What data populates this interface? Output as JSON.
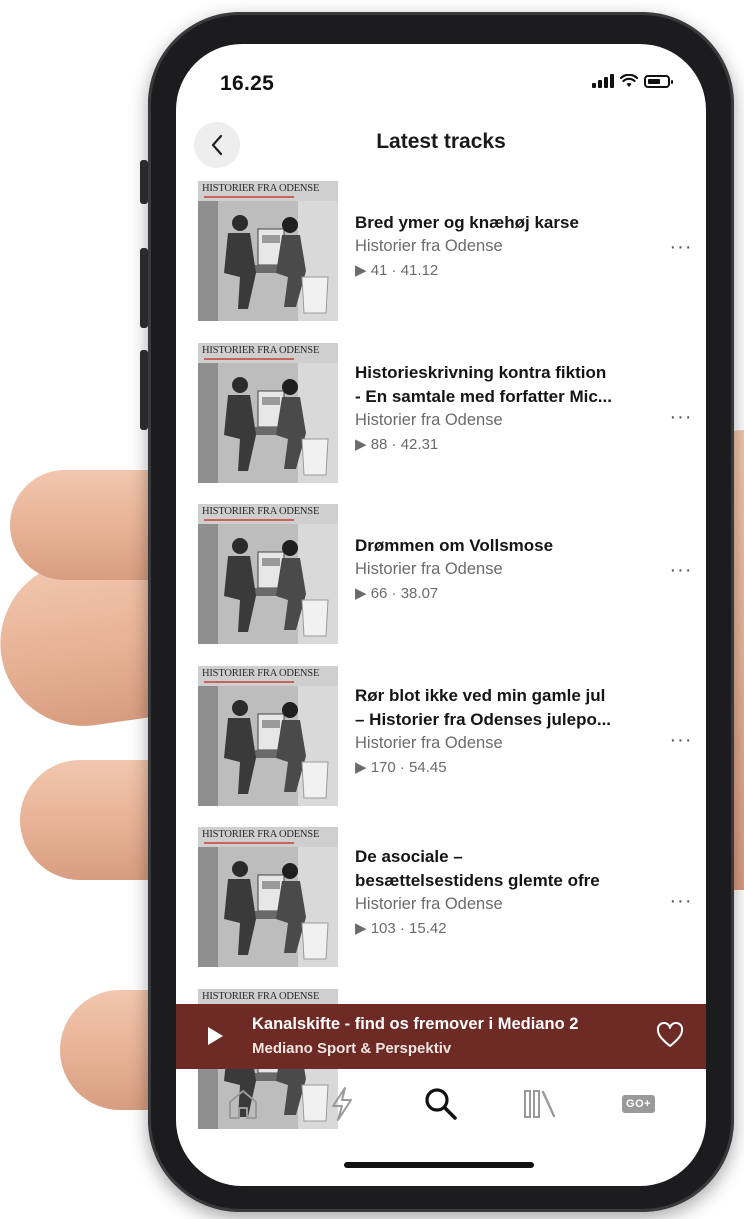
{
  "status_bar": {
    "time": "16.25"
  },
  "header": {
    "title": "Latest tracks"
  },
  "cover": {
    "title": "HISTORIER FRA ODENSE"
  },
  "tracks": [
    {
      "title_lines": [
        "Bred ymer og knæhøj karse"
      ],
      "show": "Historier fra Odense",
      "meta": "▶ 41 · 41.12"
    },
    {
      "title_lines": [
        "Historieskrivning kontra fiktion",
        "- En samtale med forfatter Mic..."
      ],
      "show": "Historier fra Odense",
      "meta": "▶ 88 · 42.31"
    },
    {
      "title_lines": [
        "Drømmen om Vollsmose"
      ],
      "show": "Historier fra Odense",
      "meta": "▶ 66 · 38.07"
    },
    {
      "title_lines": [
        "Rør blot ikke ved min gamle jul",
        "– Historier fra Odenses julepo..."
      ],
      "show": "Historier fra Odense",
      "meta": "▶ 170 · 54.45"
    },
    {
      "title_lines": [
        "De asociale –",
        "besættelsestidens glemte ofre"
      ],
      "show": "Historier fra Odense",
      "meta": "▶ 103 · 15.42"
    }
  ],
  "more_label": "···",
  "player": {
    "title": "Kanalskifte - find os fremover i Mediano 2",
    "show": "Mediano Sport & Perspektiv"
  },
  "tabbar": {
    "go_label": "GO+"
  },
  "colors": {
    "player_bg": "#6e2a24",
    "accent": "#6e2a24"
  }
}
